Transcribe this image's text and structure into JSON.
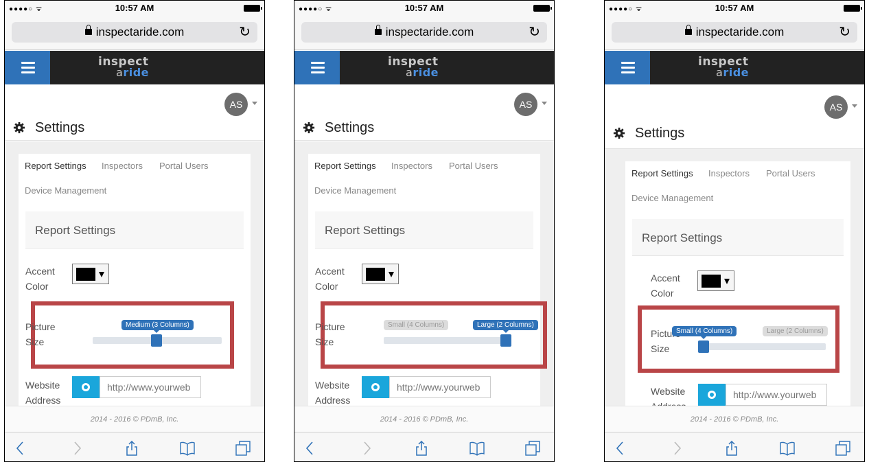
{
  "browser": {
    "time": "10:57 AM",
    "url": "inspectaride.com"
  },
  "app": {
    "logo_line1": "inspect",
    "logo_line2_a": "a",
    "logo_line2_b": "ride",
    "avatar_initials": "AS"
  },
  "page": {
    "title": "Settings",
    "tabs": [
      "Report Settings",
      "Inspectors",
      "Portal Users",
      "Device Management"
    ],
    "panel_title": "Report Settings",
    "accent_color_label_1": "Accent",
    "accent_color_label_2": "Color",
    "accent_color_value": "#000000",
    "picture_label_1": "Picture",
    "picture_label_2": "Size",
    "website_label_1": "Website",
    "website_label_2": "Address",
    "website_placeholder": "http://www.yourweb",
    "footer": "2014 - 2016 © PDmB, Inc."
  },
  "screens": [
    {
      "slider_tooltip": "Medium (3 Columns)",
      "slider_position": 0.5
    },
    {
      "slider_min_label": "Small (4 Columns)",
      "slider_max_label": "Large (2 Columns)",
      "slider_position": 1.0
    },
    {
      "slider_min_label": "Small (4 Columns)",
      "slider_max_label": "Large (2 Columns)",
      "slider_position": 0.0
    }
  ],
  "colors": {
    "accent_blue": "#2f72b8",
    "highlight_red": "#b94547",
    "web_button": "#1aa6db",
    "header_bg": "#222222"
  }
}
